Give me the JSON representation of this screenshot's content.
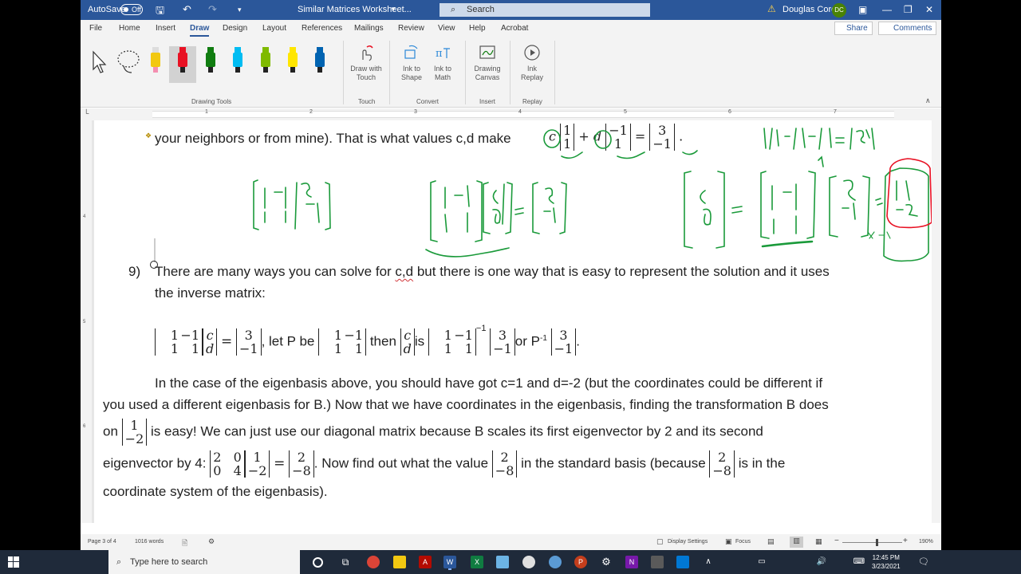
{
  "titlebar": {
    "autosave_label": "AutoSave",
    "autosave_state": "Off",
    "doc_title": "Similar Matrices Worksheet...",
    "search_placeholder": "Search",
    "user_name": "Douglas Corey",
    "user_initials": "DC"
  },
  "menu": {
    "tabs": [
      "File",
      "Home",
      "Insert",
      "Draw",
      "Design",
      "Layout",
      "References",
      "Mailings",
      "Review",
      "View",
      "Help",
      "Acrobat"
    ],
    "active": "Draw",
    "share_label": "Share",
    "comments_label": "Comments"
  },
  "ribbon": {
    "groups": {
      "drawing_tools": "Drawing Tools",
      "touch": "Touch",
      "convert": "Convert",
      "insert": "Insert",
      "replay": "Replay"
    },
    "buttons": {
      "draw_with_touch": [
        "Draw with",
        "Touch"
      ],
      "ink_to_shape": [
        "Ink to",
        "Shape"
      ],
      "ink_to_math": [
        "Ink to",
        "Math"
      ],
      "drawing_canvas": [
        "Drawing",
        "Canvas"
      ],
      "ink_replay": [
        "Ink",
        "Replay"
      ]
    },
    "pen_colors": [
      "#e81123",
      "#107c10",
      "#00bcf2",
      "#7fba00",
      "#ffe600",
      "#0063b1"
    ]
  },
  "ruler": {
    "numbers": [
      "1",
      "2",
      "3",
      "4",
      "5",
      "6",
      "7"
    ],
    "vertical_numbers": [
      "4",
      "5",
      "6"
    ]
  },
  "document": {
    "line1_text": "your neighbors or from mine). That is what values c,d make",
    "line1_eq": "=",
    "item9_number": "9)",
    "item9_text_a": "There are many ways you can solve for ",
    "item9_text_cd": "c,d",
    "item9_text_b": "  but there is one way that is easy to represent the solution and it uses",
    "item9_line2": "the inverse matrix:",
    "eq_let_p_be": ", let P be",
    "eq_then": "then",
    "eq_is": "is",
    "eq_or_p": "or P",
    "eq_or_p_sup": "-1",
    "eq_inverse_sup": "−1",
    "para_l1": "In the case of the eigenbasis above, you should have got c=1 and d=-2 (but the coordinates could be different if",
    "para_l2": "you used a different eigenbasis for B.)  Now that we have coordinates in the eigenbasis, finding the transformation B does",
    "para_l3_on": "on",
    "para_l3_rest": "is easy! We can just use our diagonal matrix because B scales its first eigenvector by 2 and its second",
    "para_l4_a": "eigenvector by 4:",
    "para_l4_b": ".  Now find out what the value",
    "para_l4_c": "in the standard basis (because",
    "para_l4_d": "is in the",
    "para_l5": "coordinate system of the eigenbasis).",
    "math": {
      "v_1_1": [
        "1",
        "1"
      ],
      "v_m1_1": [
        "−1",
        "1"
      ],
      "v_3_m1": [
        "3",
        "−1"
      ],
      "P": [
        [
          "1",
          "−1"
        ],
        [
          "1",
          "1"
        ]
      ],
      "v_c_d": [
        "c",
        "d"
      ],
      "v_1_m2": [
        "1",
        "−2"
      ],
      "D": [
        [
          "2",
          "0"
        ],
        [
          "0",
          "4"
        ]
      ],
      "v_2_m8": [
        "2",
        "−8"
      ],
      "var_c": "c",
      "var_d": "d",
      "plus": "+",
      "dot": "."
    }
  },
  "statusbar": {
    "page": "Page 3 of 4",
    "words": "1016 words",
    "display_settings": "Display Settings",
    "focus": "Focus",
    "zoom": "190%",
    "minus": "−",
    "plus": "+"
  },
  "taskbar": {
    "search_placeholder": "Type here to search",
    "time": "12:45 PM",
    "date": "3/23/2021"
  }
}
